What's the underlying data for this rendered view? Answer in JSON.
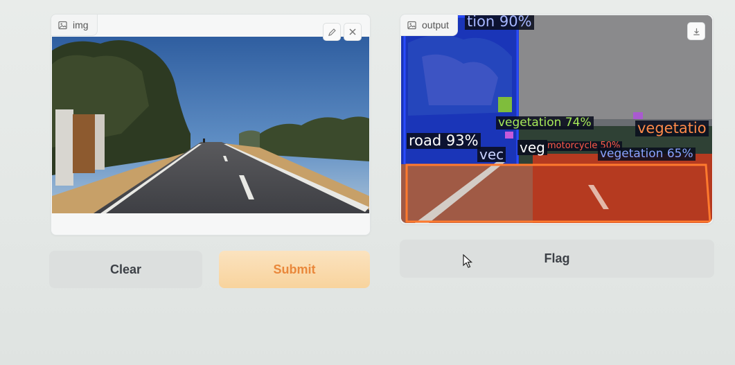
{
  "input_panel": {
    "label": "img",
    "icon": "image-icon",
    "edit_icon": "pencil-icon",
    "clear_icon": "close-icon"
  },
  "output_panel": {
    "label": "output",
    "icon": "image-icon",
    "download_icon": "download-icon",
    "detections": [
      {
        "text": "tion 90%",
        "color": "#5a7dff"
      },
      {
        "text": "vegetation 74%",
        "color": "#9be22d"
      },
      {
        "text": "road 93%",
        "color": "#ffffff"
      },
      {
        "text": "vegetatio",
        "color": "#ff7a3a"
      },
      {
        "text": "motorcycle 50%",
        "color": "#ff4a3a"
      },
      {
        "text": "vegetation 65%",
        "color": "#5a7dff"
      },
      {
        "text": "vec",
        "color": "#c9d2ff"
      },
      {
        "text": "veg",
        "color": "#ffffff"
      }
    ]
  },
  "buttons": {
    "clear": "Clear",
    "submit": "Submit",
    "flag": "Flag"
  },
  "colors": {
    "submit_text": "#e9873a",
    "submit_bg": "#f8d39d",
    "secondary_bg": "#dcdfde"
  }
}
